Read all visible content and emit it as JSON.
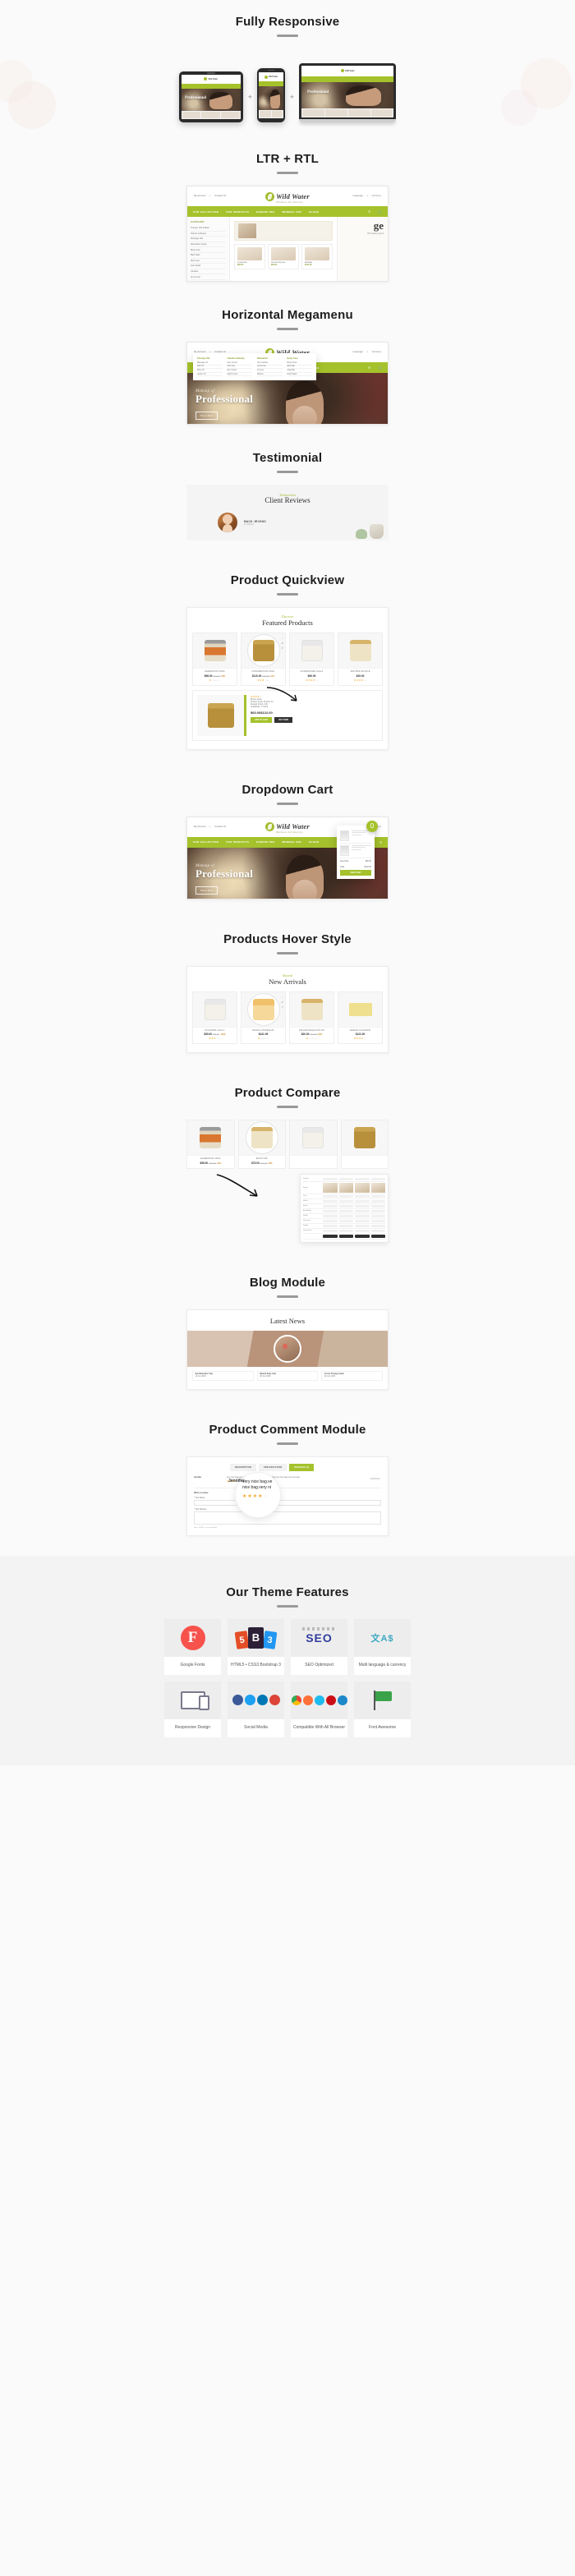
{
  "brand": {
    "name": "Wild Water",
    "tagline": "Wellness For Eternity",
    "accent": "#a5c22c"
  },
  "sections": [
    {
      "id": "responsive",
      "title": "Fully Responsive"
    },
    {
      "id": "ltrrtl",
      "title": "LTR + RTL"
    },
    {
      "id": "megamenu",
      "title": "Horizontal Megamenu"
    },
    {
      "id": "testimonial",
      "title": "Testimonial"
    },
    {
      "id": "quickview",
      "title": "Product Quickview"
    },
    {
      "id": "dropdowncart",
      "title": "Dropdown Cart"
    },
    {
      "id": "hover",
      "title": "Products Hover Style"
    },
    {
      "id": "compare",
      "title": "Product Compare"
    },
    {
      "id": "blog",
      "title": "Blog Module"
    },
    {
      "id": "comment",
      "title": "Product Comment Module"
    },
    {
      "id": "features",
      "title": "Our Theme Features"
    }
  ],
  "topbar": {
    "left": [
      "My Account",
      "Contact Us"
    ],
    "right": [
      "Language",
      "Currency"
    ]
  },
  "nav": [
    "OUR COLLECTION",
    "OUR PRODUCTS",
    "EINGEDI SPA",
    "MINERAL SPA",
    "BLOGS"
  ],
  "nav_icons": {
    "search": "search-icon",
    "cart": "cart-icon",
    "cart_count": "0"
  },
  "hero": {
    "kicker": "Makeup of",
    "headline": "Professional",
    "button": "Shop Now"
  },
  "category": {
    "heading": "CATEGORY",
    "items": [
      "Therapy Oils & Balm",
      "Vitamin & Beauty",
      "Massage Oils",
      "Relaxation Soaps",
      "Body Care",
      "Bath Salts",
      "Skin Care",
      "Face Mask",
      "Candles",
      "Aroma Set"
    ],
    "promo_title": "OUR COLLECTION",
    "products": [
      {
        "name": "DIGNISSIM",
        "price": "$50.00"
      },
      {
        "name": "PELLENTESQUE",
        "price": "$20.00"
      },
      {
        "name": "AENEAN",
        "price": "$122.00"
      }
    ],
    "rtl_word": "ge",
    "rtl_sub": "RTL Ready Layout"
  },
  "megamenu": {
    "columns": [
      {
        "heading": "Therapy Oils",
        "items": [
          "Massage Oil",
          "Bath Oil",
          "Body Oil",
          "Carrier Oil"
        ]
      },
      {
        "heading": "Vitamin & Beauty",
        "items": [
          "Face Serum",
          "Hair Care",
          "Day Cream",
          "Night Cream"
        ]
      },
      {
        "heading": "Relaxation",
        "items": [
          "Soy Candles",
          "Aroma Set",
          "Incense",
          "Diffuser"
        ]
      },
      {
        "heading": "Body Care",
        "items": [
          "Body Scrub",
          "Bath Salt",
          "Soap Bar",
          "Hand Wash"
        ]
      }
    ]
  },
  "testimonial": {
    "kicker": "Testimonials",
    "title": "Client Reviews",
    "author": "MACK JECKNO",
    "role": "Prestashop",
    "quote": "Every characteristic of our spa products is important to us, and our customers. Thank you for visiting."
  },
  "featured": {
    "kicker": "Discover",
    "title": "Featured Products",
    "products": [
      {
        "name": "ELEMENTUM URNA",
        "price": "$98.00",
        "old": "$122.00",
        "off": "20%",
        "rating": 1
      },
      {
        "name": "CONDIMENTUM NUNC",
        "price": "$110.00",
        "old": "$122.00",
        "off": "10%",
        "rating": 3
      },
      {
        "name": "SUSPENDISSE NULLA",
        "price": "$96.00",
        "old": "",
        "off": "",
        "rating": 4
      },
      {
        "name": "VESTIBULUM ANTE",
        "price": "$45.00",
        "old": "",
        "off": "",
        "rating": 4
      }
    ],
    "quickview": {
      "rating": 4,
      "brand": "Brand: Apple",
      "code": "Product Code: Product 14",
      "reward": "Reward Points: 400",
      "availability": "Availability: In Stock",
      "price": "$60.00",
      "old": "$122.00",
      "add_to_cart": "ADD TO CART",
      "buy_now": "BUY NOW"
    }
  },
  "newarrivals": {
    "kicker": "Natural",
    "title": "New Arrivals",
    "products": [
      {
        "name": "DIGNISSIM LIGULA",
        "price": "$50.00",
        "old": "$25.00",
        "off": "-100%",
        "rating": 3
      },
      {
        "name": "MAGNA CONSEQUAT",
        "price": "$241.99",
        "old": "",
        "off": "",
        "rating": 1
      },
      {
        "name": "PELLENTESQUE DOLOR",
        "price": "$20.00",
        "old": "$102.00",
        "off": "80%",
        "rating": 1
      },
      {
        "name": "AENEAN DIGNISSIM",
        "price": "$122.00",
        "old": "",
        "off": "",
        "rating": 4
      }
    ]
  },
  "compare": {
    "products": [
      {
        "name": "ELEMENTUM URNA",
        "price": "$98.00",
        "old": "$122.00",
        "off": "20%"
      },
      {
        "name": "EFFICITUR",
        "price": "$75.00",
        "old": "$122.00",
        "off": "38%"
      }
    ],
    "table_rows": [
      "Product",
      "Image",
      "Price",
      "Model",
      "Brand",
      "Availability",
      "Rating",
      "Summary",
      "Weight",
      "Dimensions"
    ],
    "table_action": "ADD TO CART"
  },
  "blog": {
    "title": "Latest News",
    "posts": [
      {
        "title": "Spa Relaxation Tips",
        "meta": "12 Jun 2018"
      },
      {
        "title": "Natural Body Care",
        "meta": "08 Jun 2018"
      },
      {
        "title": "Aroma Therapy Guide",
        "meta": "02 Jun 2018"
      }
    ]
  },
  "review": {
    "tabs": [
      "DESCRIPTION",
      "SPECIFICATION",
      "REVIEWS (1)"
    ],
    "active_tab": "REVIEWS (1)",
    "reviewer_name": "Jennifer",
    "reviewer_handle": "Jennifer",
    "date": "13/04/2018",
    "text": "very nice bag.very nice bag.very nice bag.very nice bag.very nice bag.very nice bag.",
    "zoom_line1": "very nice bag.ve",
    "zoom_line2": "nice bag.very ni",
    "rating": 4,
    "form_heading": "Write a review",
    "name_label": "Your Name",
    "review_label": "Your Review",
    "note": "Note: HTML is not translated!"
  },
  "features": {
    "title": "Our Theme Features",
    "items": [
      {
        "label": "Google Fonts",
        "icon": "google-fonts-icon"
      },
      {
        "label": "HTML5 • CSS3\nBootstrap 3",
        "icon": "html5-css3-bootstrap-icon"
      },
      {
        "label": "SEO Optimized",
        "icon": "seo-icon"
      },
      {
        "label": "Multi language &\ncurrency",
        "icon": "multi-language-icon"
      },
      {
        "label": "Responsive Design",
        "icon": "responsive-design-icon"
      },
      {
        "label": "Social Media",
        "icon": "social-media-icon"
      },
      {
        "label": "Compatible With\nAll Browser",
        "icon": "browser-compat-icon"
      },
      {
        "label": "Font Awesome",
        "icon": "font-awesome-icon"
      }
    ]
  }
}
